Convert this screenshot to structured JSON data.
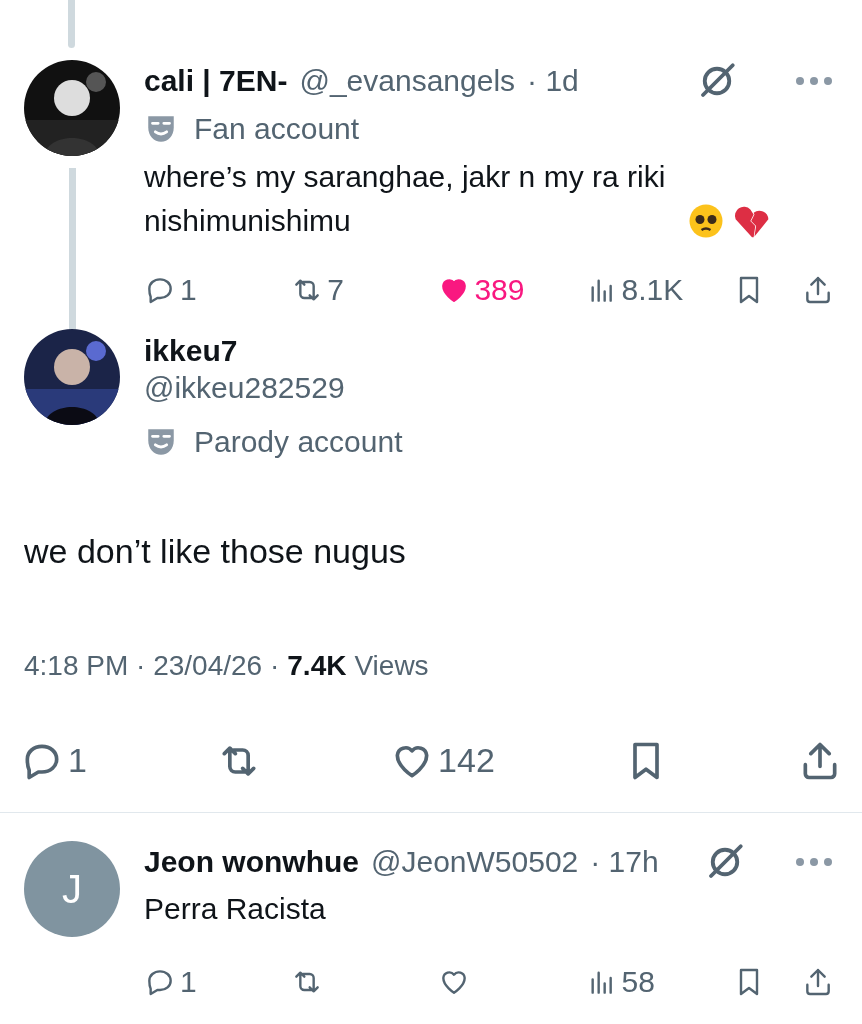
{
  "parent_reply": {
    "separator": "·",
    "name": "cali | 7EN-",
    "handle": "@_evansangels",
    "time": "1d",
    "badge": "Fan account",
    "text": "where’s my saranghae, jakr n my ra riki nishimunishimu",
    "liked": true,
    "actions": [
      {
        "kind": "reply",
        "count": "1"
      },
      {
        "kind": "retweet",
        "count": "7"
      },
      {
        "kind": "like",
        "count": "389"
      },
      {
        "kind": "views",
        "count": "8.1K"
      },
      {
        "kind": "bookmark"
      },
      {
        "kind": "share"
      }
    ]
  },
  "main_post": {
    "separator": "·",
    "name": "ikkeu7",
    "handle": "@ikkeu282529",
    "badge": "Parody account",
    "text": "we don’t like those nugus",
    "time": "4:18 PM",
    "date": "23/04/26",
    "views": "7.4K",
    "views_label": "Views",
    "liked": false,
    "actions": [
      {
        "kind": "reply",
        "count": "1"
      },
      {
        "kind": "retweet"
      },
      {
        "kind": "like",
        "count": "142"
      },
      {
        "kind": "bookmark"
      },
      {
        "kind": "share"
      }
    ]
  },
  "replies": [
    {
      "separator": "·",
      "name": "Jeon wonwhue",
      "handle": "@JeonW50502",
      "time": "17h",
      "avatar_letter": "J",
      "text": "Perra Racista",
      "liked": false,
      "actions": [
        {
          "kind": "reply",
          "count": "1"
        },
        {
          "kind": "retweet"
        },
        {
          "kind": "like"
        },
        {
          "kind": "views",
          "count": "58"
        },
        {
          "kind": "bookmark"
        },
        {
          "kind": "share"
        }
      ]
    }
  ]
}
